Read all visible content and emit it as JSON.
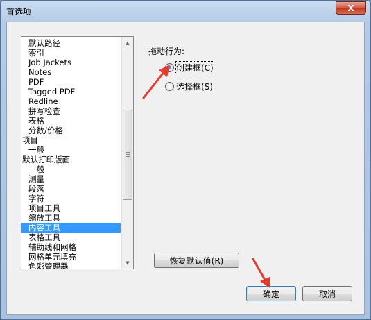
{
  "window": {
    "title": "首选项",
    "close_label": "X"
  },
  "sidebar": {
    "items": [
      {
        "label": "默认路径",
        "level": 1
      },
      {
        "label": "索引",
        "level": 1
      },
      {
        "label": "Job Jackets",
        "level": 1
      },
      {
        "label": "Notes",
        "level": 1
      },
      {
        "label": "PDF",
        "level": 1
      },
      {
        "label": "Tagged PDF",
        "level": 1
      },
      {
        "label": "Redline",
        "level": 1
      },
      {
        "label": "拼写检查",
        "level": 1
      },
      {
        "label": "表格",
        "level": 1
      },
      {
        "label": "分数/价格",
        "level": 1
      },
      {
        "label": "项目",
        "level": 0
      },
      {
        "label": "一般",
        "level": 1
      },
      {
        "label": "默认打印版面",
        "level": 0
      },
      {
        "label": "一般",
        "level": 1
      },
      {
        "label": "测量",
        "level": 1
      },
      {
        "label": "段落",
        "level": 1
      },
      {
        "label": "字符",
        "level": 1
      },
      {
        "label": "项目工具",
        "level": 1
      },
      {
        "label": "缩放工具",
        "level": 1
      },
      {
        "label": "内容工具",
        "level": 1,
        "selected": true
      },
      {
        "label": "表格工具",
        "level": 1
      },
      {
        "label": "辅助线和网格",
        "level": 1
      },
      {
        "label": "网格单元填充",
        "level": 1
      },
      {
        "label": "色彩管理器",
        "level": 1
      }
    ]
  },
  "panel": {
    "group_label": "拖动行为:",
    "options": [
      {
        "label": "创建框(C)",
        "checked": true
      },
      {
        "label": "选择框(S)",
        "checked": false
      }
    ],
    "restore_label": "恢复默认值(R)"
  },
  "footer": {
    "ok_label": "确定",
    "cancel_label": "取消"
  },
  "colors": {
    "selection": "#3399ff",
    "annotation_arrow": "#e8392c"
  }
}
